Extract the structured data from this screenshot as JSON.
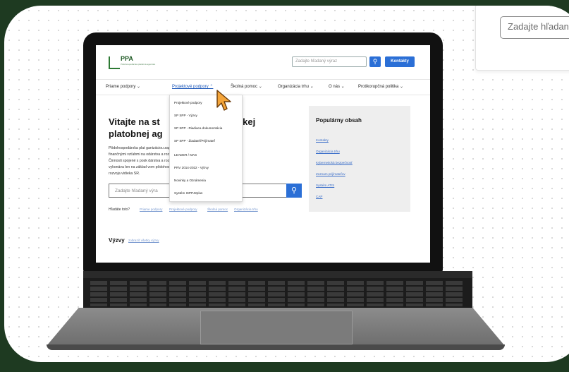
{
  "popup": {
    "search_placeholder": "Zadajte hľadaný"
  },
  "site": {
    "logo_text": "PPA",
    "logo_subtext": "Pôdohospodárska platobná agentúra",
    "search_placeholder": "Zadajte hľadaný výraz",
    "contact_label": "Kontakty",
    "nav": [
      {
        "label": "Priame podpory ⌄"
      },
      {
        "label": "Projektové podpory ⌃"
      },
      {
        "label": "Školná pomoc ⌄"
      },
      {
        "label": "Organizácia trhu ⌄"
      },
      {
        "label": "O nás ⌄"
      },
      {
        "label": "Protikorupčná politika ⌄"
      }
    ],
    "dropdown": [
      {
        "label": "Projektové podpory"
      },
      {
        "label": "SP SPP - Výzvy"
      },
      {
        "label": "SP SPP - Riadiaca dokumentácia"
      },
      {
        "label": "SP SPP - Žiadateľ/Prijímateľ"
      },
      {
        "label": "LEADER / MAS"
      },
      {
        "label": "PRV 2014-2022 - Výzvy"
      },
      {
        "label": "Novinky a Oznámenia"
      },
      {
        "label": "Systém ISPPJ2plus"
      }
    ],
    "hero": {
      "title_line1": "Vitajte na st",
      "title_line1_end": "odárskej",
      "title_line2": "platobnej ag",
      "text_lines": [
        "Pôdohospodárska plat             ganizáciou zapojenou",
        "finančnými vzťahmi na             odárstva a rozvoja vidieka SR.",
        "Činnosti spojené s posk              dárstva a rozvoji vidieka",
        "vykonáva len na základ            vom pôdohospodárstva a",
        "rozvoja vidieka SR."
      ]
    },
    "main_search_placeholder": "Zadajte hľadaný výra",
    "suggest_label": "Hľadáte toto?",
    "suggest_links": [
      "Priame podpory",
      "Projektové podpory",
      "Školná pomoc",
      "Organizácia trhu"
    ],
    "vyzvy_label": "Výzvy",
    "vyzvy_link": "zobraziť všetky výzvy",
    "popular_title": "Populárny obsah",
    "popular_links": [
      "Kontakty",
      "Organizácia trhu",
      "Kybernetická bezpečnosť",
      "Zoznam prijímateľov",
      "Systém ATIS",
      "CAP"
    ]
  },
  "colors": {
    "accent": "#2b6fd6",
    "frame": "#1e3a21"
  }
}
